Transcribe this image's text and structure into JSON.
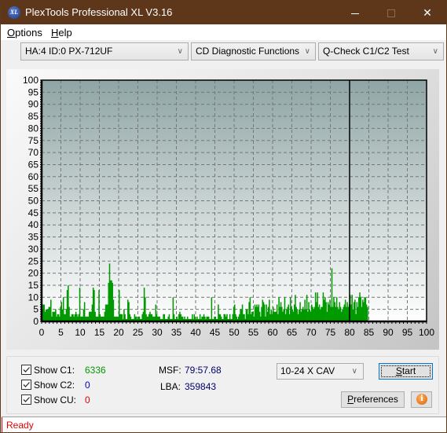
{
  "window": {
    "title": "PlexTools Professional XL V3.16",
    "app_icon_text": "XL",
    "minimize_label": "",
    "close_label": "✕"
  },
  "menu": {
    "items": [
      {
        "label": "Options",
        "accel": "O"
      },
      {
        "label": "Help",
        "accel": "H"
      }
    ]
  },
  "toolbar": {
    "drive": "HA:4 ID:0  PX-712UF",
    "function": "CD Diagnostic Functions",
    "test": "Q-Check C1/C2 Test"
  },
  "chart_data": {
    "type": "bar",
    "title": "",
    "xlabel": "",
    "ylabel": "",
    "xlim": [
      0,
      100
    ],
    "ylim": [
      0,
      100
    ],
    "x_ticks": [
      "0",
      "5",
      "10",
      "15",
      "20",
      "25",
      "30",
      "35",
      "40",
      "45",
      "50",
      "55",
      "60",
      "65",
      "70",
      "75",
      "80",
      "85",
      "90",
      "95",
      "100"
    ],
    "y_ticks": [
      "0",
      "5",
      "10",
      "15",
      "20",
      "25",
      "30",
      "35",
      "40",
      "45",
      "50",
      "55",
      "60",
      "65",
      "70",
      "75",
      "80",
      "85",
      "90",
      "95",
      "100"
    ],
    "grid": true,
    "progress_marker_x": 80,
    "series": [
      {
        "name": "C1",
        "color": "#009900",
        "x_start": 0,
        "x_step": 0.25,
        "values": [
          5,
          7,
          7,
          4,
          5,
          5,
          5,
          6,
          6,
          9,
          2,
          4,
          4,
          4,
          5,
          2,
          3,
          3,
          2,
          6,
          8,
          5,
          10,
          3,
          3,
          5,
          13,
          15,
          6,
          2,
          2,
          3,
          3,
          2,
          3,
          4,
          3,
          2,
          3,
          14,
          2,
          2,
          2,
          5,
          8,
          2,
          2,
          2,
          2,
          4,
          4,
          4,
          7,
          14,
          13,
          4,
          2,
          2,
          2,
          13,
          3,
          2,
          2,
          2,
          2,
          4,
          7,
          7,
          7,
          16,
          24,
          17,
          17,
          16,
          9,
          2,
          2,
          2,
          2,
          2,
          13,
          3,
          3,
          3,
          1,
          5,
          3,
          1,
          1,
          9,
          8,
          3,
          2,
          1,
          1,
          1,
          3,
          2,
          2,
          1,
          2,
          2,
          1,
          1,
          3,
          4,
          14,
          10,
          3,
          2,
          2,
          3,
          4,
          3,
          3,
          2,
          2,
          2,
          7,
          3,
          2,
          2,
          2,
          1,
          1,
          1,
          3,
          3,
          1,
          1,
          1,
          2,
          3,
          1,
          1,
          1,
          10,
          3,
          1,
          1,
          2,
          1,
          3,
          4,
          3,
          2,
          2,
          1,
          2,
          1,
          1,
          2,
          1,
          1,
          1,
          1,
          3,
          1,
          3,
          2,
          1,
          2,
          1,
          1,
          3,
          1,
          2,
          2,
          3,
          2,
          1,
          2,
          2,
          2,
          1,
          1,
          10,
          1,
          1,
          2,
          2,
          1,
          1,
          7,
          3,
          3,
          2,
          1,
          1,
          3,
          3,
          2,
          3,
          1,
          1,
          3,
          1,
          1,
          3,
          6,
          7,
          3,
          2,
          1,
          2,
          3,
          5,
          5,
          7,
          3,
          3,
          1,
          5,
          5,
          3,
          8,
          10,
          3,
          4,
          4,
          2,
          7,
          6,
          7,
          6,
          7,
          4,
          2,
          6,
          9,
          8,
          7,
          2,
          7,
          4,
          6,
          9,
          3,
          5,
          3,
          6,
          4,
          4,
          4,
          7,
          3,
          10,
          6,
          8,
          6,
          4,
          5,
          10,
          3,
          5,
          6,
          7,
          3,
          10,
          6,
          5,
          4,
          7,
          11,
          6,
          5,
          3,
          5,
          8,
          4,
          5,
          6,
          5,
          9,
          5,
          11,
          4,
          8,
          5,
          4,
          7,
          6,
          5,
          6,
          12,
          8,
          12,
          6,
          7,
          5,
          6,
          6,
          12,
          9,
          10,
          8,
          4,
          8,
          7,
          9,
          6,
          22,
          6,
          10,
          8,
          6,
          10,
          6,
          5,
          8,
          6,
          4,
          5,
          6,
          7,
          9,
          6,
          8,
          6,
          7,
          11,
          7,
          11,
          5,
          8,
          9,
          3,
          8,
          6,
          10,
          12,
          10,
          6,
          9,
          8,
          10,
          10,
          7,
          6
        ]
      }
    ]
  },
  "stats": {
    "show_c1_label": "Show C1:",
    "show_c2_label": "Show C2:",
    "show_cu_label": "Show CU:",
    "show_c1": true,
    "show_c2": true,
    "show_cu": true,
    "c1_value": "6336",
    "c2_value": "0",
    "cu_value": "0",
    "c1_color": "#009900",
    "c2_color": "#0000cc",
    "cu_color": "#e00000",
    "msf_label": "MSF:",
    "msf_value": "79:57.68",
    "lba_label": "LBA:",
    "lba_value": "359843"
  },
  "controls": {
    "speed": "10-24 X CAV",
    "start_label": "Start",
    "start_accel": "S",
    "preferences_label": "Preferences",
    "preferences_accel": "P",
    "info_icon": "i"
  },
  "status": {
    "text": "Ready"
  }
}
